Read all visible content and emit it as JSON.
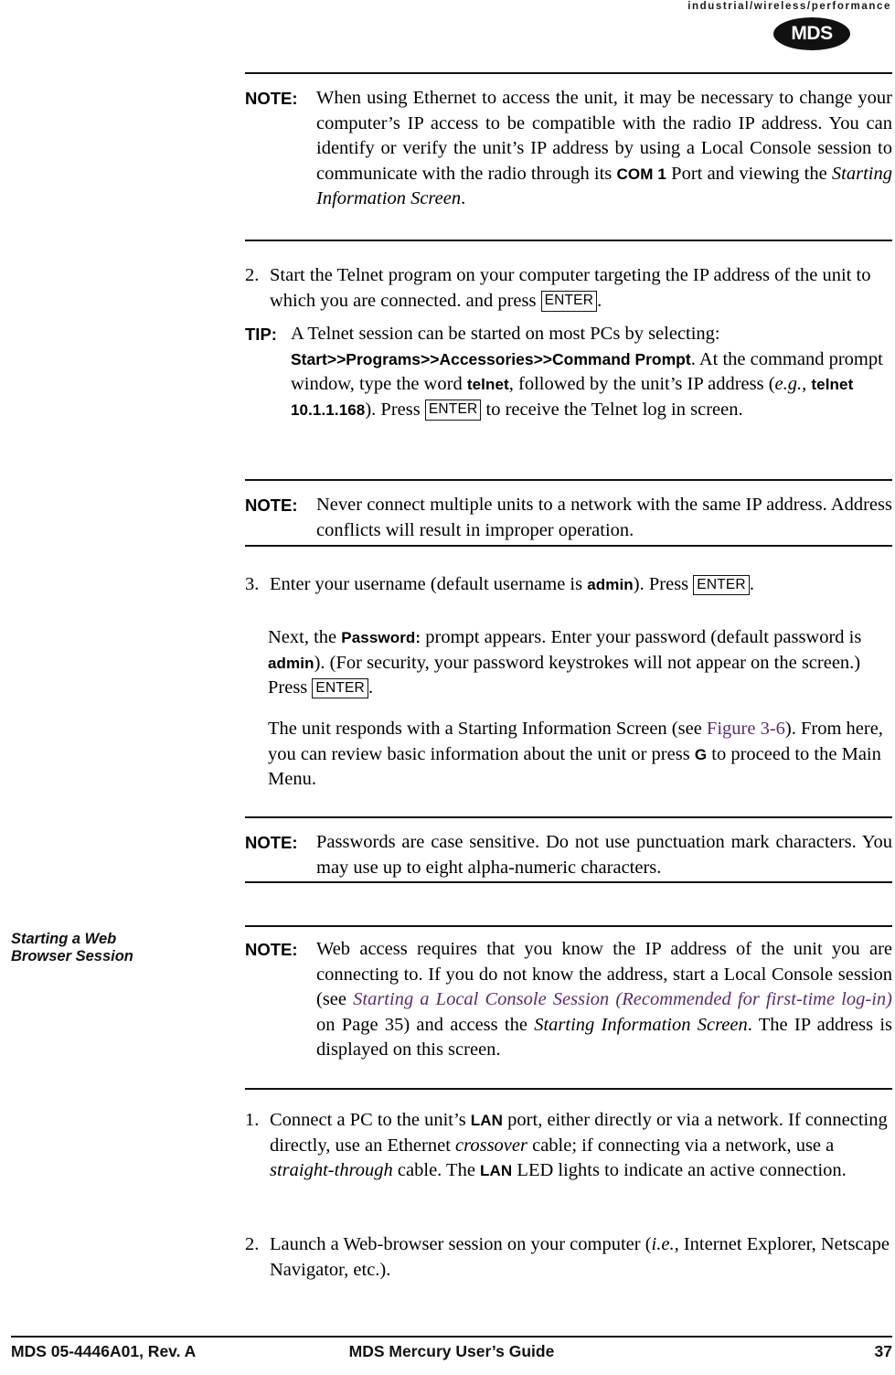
{
  "masthead": {
    "tagline": "industrial/wireless/performance",
    "logo_text": "MDS"
  },
  "marginalia": {
    "section_heading_line1": "Starting a Web",
    "section_heading_line2": "Browser Session"
  },
  "labels": {
    "note": "NOTE:",
    "tip": "TIP:",
    "enter_key": "ENTER"
  },
  "blocks": {
    "note_ethernet": {
      "t1": "When using Ethernet to access the unit, it may be necessary to change your computer’s IP access to be compatible with the radio IP address. You can identify or verify the unit’s IP address by using a Local Console session to communicate with the radio through its ",
      "com": "COM 1",
      "t2": " Port and viewing the ",
      "it1": "Starting Information Screen",
      "t3": "."
    },
    "step_2_telnet": {
      "num": "2.",
      "t1": "Start the Telnet program on your computer targeting the IP address of the unit to which you are connected. and press ",
      "t2": "."
    },
    "tip_telnet": {
      "t1": "A Telnet session can be started on most PCs by selecting: ",
      "path": "Start>>Programs>>Accessories>>Command Prompt",
      "t2": ". At the command prompt window, type the word ",
      "cmd1": "telnet",
      "t3": ", followed by the unit’s IP address (",
      "eg": "e.g.",
      "t4": ", ",
      "cmd2": "telnet 10.1.1.168",
      "t5": "). Press ",
      "t6": " to receive the Telnet log in screen."
    },
    "note_multiple_units": {
      "t1": "Never connect multiple units to a network with the same IP address. Address conflicts will result in improper operation."
    },
    "step_3_username": {
      "num": "3.",
      "t1": "Enter your username (default username is ",
      "cmd": "admin",
      "t2": "). Press ",
      "t3": "."
    },
    "para_password": {
      "t1": "Next, the ",
      "cmd1": "Password:",
      "t2": " prompt appears. Enter your password (default password is ",
      "cmd2": "admin",
      "t3": "). (For security, your password keystrokes will not appear on the screen.) Press ",
      "t4": "."
    },
    "para_starting_info": {
      "t1": "The unit responds with a Starting Information Screen (see ",
      "xref": "Figure 3-6",
      "t2": "). From here, you can review basic information about the unit or press ",
      "cmd": "G",
      "t3": " to proceed to the Main Menu."
    },
    "note_passwords": {
      "t1": "Passwords are case sensitive. Do not use punctuation mark characters. You may use up to eight alpha-numeric characters."
    },
    "note_web_access": {
      "t1": "Web access requires that you know the IP address of the unit you are connecting to. If you do not know the address, start a Local Console session (see ",
      "xref": "Starting a Local Console Session (Recommended for first-time log-in)",
      "t2": " on Page 35) and access the ",
      "it1": "Starting Information Screen",
      "t3": ". The IP address is displayed on this screen."
    },
    "step_1_connect": {
      "num": "1.",
      "t1": "Connect a PC to the unit’s ",
      "lan1": "LAN",
      "t2": " port, either directly or via a network. If connecting directly, use an Ethernet ",
      "it1": "crossover",
      "t3": " cable; if connecting via a network, use a ",
      "it2": "straight-through",
      "t4": " cable. The ",
      "lan2": "LAN",
      "t5": " LED lights to indicate an active connection."
    },
    "step_2_launch": {
      "num": "2.",
      "t1": "Launch a Web-browser session on your computer (",
      "ie": "i.e.,",
      "t2": " Internet Explorer, Netscape Navigator, etc.)."
    }
  },
  "footer": {
    "left": "MDS 05-4446A01, Rev. A",
    "center": "MDS Mercury User’s Guide",
    "right": "37"
  },
  "colors": {
    "xref": "#5b2d6e",
    "ink": "#111111"
  }
}
